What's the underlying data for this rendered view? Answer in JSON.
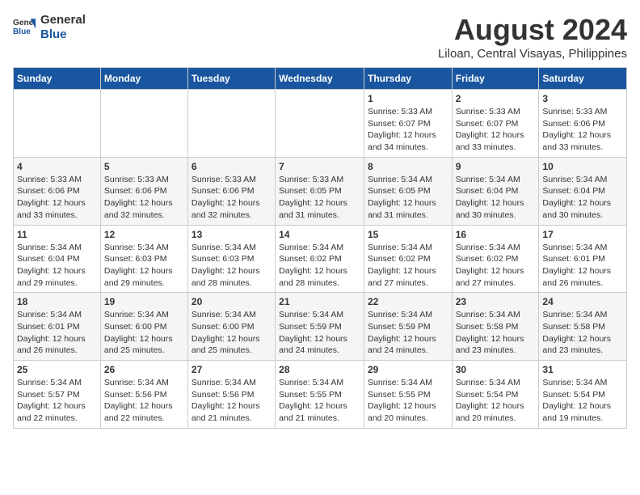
{
  "logo": {
    "line1": "General",
    "line2": "Blue"
  },
  "title": "August 2024",
  "subtitle": "Liloan, Central Visayas, Philippines",
  "days_of_week": [
    "Sunday",
    "Monday",
    "Tuesday",
    "Wednesday",
    "Thursday",
    "Friday",
    "Saturday"
  ],
  "weeks": [
    [
      {
        "day": "",
        "info": ""
      },
      {
        "day": "",
        "info": ""
      },
      {
        "day": "",
        "info": ""
      },
      {
        "day": "",
        "info": ""
      },
      {
        "day": "1",
        "info": "Sunrise: 5:33 AM\nSunset: 6:07 PM\nDaylight: 12 hours\nand 34 minutes."
      },
      {
        "day": "2",
        "info": "Sunrise: 5:33 AM\nSunset: 6:07 PM\nDaylight: 12 hours\nand 33 minutes."
      },
      {
        "day": "3",
        "info": "Sunrise: 5:33 AM\nSunset: 6:06 PM\nDaylight: 12 hours\nand 33 minutes."
      }
    ],
    [
      {
        "day": "4",
        "info": "Sunrise: 5:33 AM\nSunset: 6:06 PM\nDaylight: 12 hours\nand 33 minutes."
      },
      {
        "day": "5",
        "info": "Sunrise: 5:33 AM\nSunset: 6:06 PM\nDaylight: 12 hours\nand 32 minutes."
      },
      {
        "day": "6",
        "info": "Sunrise: 5:33 AM\nSunset: 6:06 PM\nDaylight: 12 hours\nand 32 minutes."
      },
      {
        "day": "7",
        "info": "Sunrise: 5:33 AM\nSunset: 6:05 PM\nDaylight: 12 hours\nand 31 minutes."
      },
      {
        "day": "8",
        "info": "Sunrise: 5:34 AM\nSunset: 6:05 PM\nDaylight: 12 hours\nand 31 minutes."
      },
      {
        "day": "9",
        "info": "Sunrise: 5:34 AM\nSunset: 6:04 PM\nDaylight: 12 hours\nand 30 minutes."
      },
      {
        "day": "10",
        "info": "Sunrise: 5:34 AM\nSunset: 6:04 PM\nDaylight: 12 hours\nand 30 minutes."
      }
    ],
    [
      {
        "day": "11",
        "info": "Sunrise: 5:34 AM\nSunset: 6:04 PM\nDaylight: 12 hours\nand 29 minutes."
      },
      {
        "day": "12",
        "info": "Sunrise: 5:34 AM\nSunset: 6:03 PM\nDaylight: 12 hours\nand 29 minutes."
      },
      {
        "day": "13",
        "info": "Sunrise: 5:34 AM\nSunset: 6:03 PM\nDaylight: 12 hours\nand 28 minutes."
      },
      {
        "day": "14",
        "info": "Sunrise: 5:34 AM\nSunset: 6:02 PM\nDaylight: 12 hours\nand 28 minutes."
      },
      {
        "day": "15",
        "info": "Sunrise: 5:34 AM\nSunset: 6:02 PM\nDaylight: 12 hours\nand 27 minutes."
      },
      {
        "day": "16",
        "info": "Sunrise: 5:34 AM\nSunset: 6:02 PM\nDaylight: 12 hours\nand 27 minutes."
      },
      {
        "day": "17",
        "info": "Sunrise: 5:34 AM\nSunset: 6:01 PM\nDaylight: 12 hours\nand 26 minutes."
      }
    ],
    [
      {
        "day": "18",
        "info": "Sunrise: 5:34 AM\nSunset: 6:01 PM\nDaylight: 12 hours\nand 26 minutes."
      },
      {
        "day": "19",
        "info": "Sunrise: 5:34 AM\nSunset: 6:00 PM\nDaylight: 12 hours\nand 25 minutes."
      },
      {
        "day": "20",
        "info": "Sunrise: 5:34 AM\nSunset: 6:00 PM\nDaylight: 12 hours\nand 25 minutes."
      },
      {
        "day": "21",
        "info": "Sunrise: 5:34 AM\nSunset: 5:59 PM\nDaylight: 12 hours\nand 24 minutes."
      },
      {
        "day": "22",
        "info": "Sunrise: 5:34 AM\nSunset: 5:59 PM\nDaylight: 12 hours\nand 24 minutes."
      },
      {
        "day": "23",
        "info": "Sunrise: 5:34 AM\nSunset: 5:58 PM\nDaylight: 12 hours\nand 23 minutes."
      },
      {
        "day": "24",
        "info": "Sunrise: 5:34 AM\nSunset: 5:58 PM\nDaylight: 12 hours\nand 23 minutes."
      }
    ],
    [
      {
        "day": "25",
        "info": "Sunrise: 5:34 AM\nSunset: 5:57 PM\nDaylight: 12 hours\nand 22 minutes."
      },
      {
        "day": "26",
        "info": "Sunrise: 5:34 AM\nSunset: 5:56 PM\nDaylight: 12 hours\nand 22 minutes."
      },
      {
        "day": "27",
        "info": "Sunrise: 5:34 AM\nSunset: 5:56 PM\nDaylight: 12 hours\nand 21 minutes."
      },
      {
        "day": "28",
        "info": "Sunrise: 5:34 AM\nSunset: 5:55 PM\nDaylight: 12 hours\nand 21 minutes."
      },
      {
        "day": "29",
        "info": "Sunrise: 5:34 AM\nSunset: 5:55 PM\nDaylight: 12 hours\nand 20 minutes."
      },
      {
        "day": "30",
        "info": "Sunrise: 5:34 AM\nSunset: 5:54 PM\nDaylight: 12 hours\nand 20 minutes."
      },
      {
        "day": "31",
        "info": "Sunrise: 5:34 AM\nSunset: 5:54 PM\nDaylight: 12 hours\nand 19 minutes."
      }
    ]
  ]
}
